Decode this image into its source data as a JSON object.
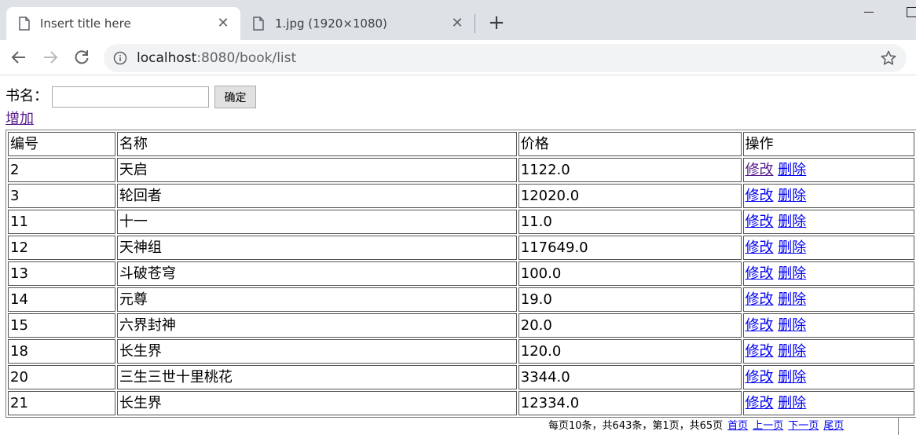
{
  "browser": {
    "tabs": [
      {
        "title": "Insert title here",
        "active": true
      },
      {
        "title": "1.jpg (1920×1080)",
        "active": false
      }
    ],
    "close_glyph": "✕",
    "new_tab_glyph": "+",
    "url_host": "localhost",
    "url_rest": ":8080/book/list"
  },
  "search": {
    "label": "书名：",
    "value": "",
    "button_label": "确定"
  },
  "add_link": "增加",
  "table": {
    "headers": [
      "编号",
      "名称",
      "价格",
      "操作"
    ],
    "edit_label": "修改",
    "delete_label": "删除",
    "rows": [
      {
        "id": "2",
        "name": "天启",
        "price": "1122.0"
      },
      {
        "id": "3",
        "name": "轮回者",
        "price": "12020.0"
      },
      {
        "id": "11",
        "name": "十一",
        "price": "11.0"
      },
      {
        "id": "12",
        "name": "天神组",
        "price": "117649.0"
      },
      {
        "id": "13",
        "name": "斗破苍穹",
        "price": "100.0"
      },
      {
        "id": "14",
        "name": "元尊",
        "price": "19.0"
      },
      {
        "id": "15",
        "name": "六界封神",
        "price": "20.0"
      },
      {
        "id": "18",
        "name": "长生界",
        "price": "120.0"
      },
      {
        "id": "20",
        "name": "三生三世十里桃花",
        "price": "3344.0"
      },
      {
        "id": "21",
        "name": "长生界",
        "price": "12334.0"
      }
    ]
  },
  "pager": {
    "summary": "每页10条，共643条，第1页，共65页",
    "first": "首页",
    "prev": "上一页",
    "next": "下一页",
    "last": "尾页"
  },
  "colors": {
    "link": "#0000ee",
    "visited_link": "#551a8b",
    "tabstrip": "#dee1e6",
    "omnibox": "#f1f3f4"
  }
}
